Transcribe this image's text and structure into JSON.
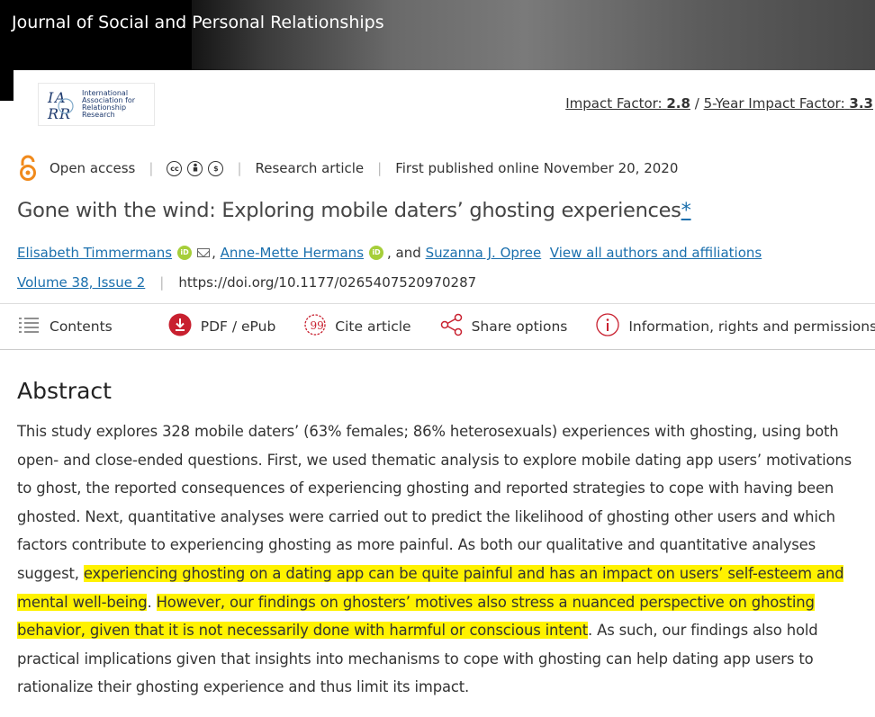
{
  "header": {
    "journal_title": "Journal of Social and Personal Relationships"
  },
  "brand": {
    "logo_text": "International Association for Relationship Research",
    "impact_label": "Impact Factor:",
    "impact_value": "2.8",
    "separator": "/",
    "five_year_label": "5-Year Impact Factor:",
    "five_year_value": "3.3"
  },
  "meta": {
    "access": "Open access",
    "article_type": "Research article",
    "published": "First published online November 20, 2020",
    "license_icons": [
      "cc-icon",
      "by-icon",
      "nc-icon"
    ]
  },
  "article": {
    "title": "Gone with the wind: Exploring mobile daters’ ghosting experiences",
    "title_mark": "*"
  },
  "authors": {
    "author1": "Elisabeth Timmermans",
    "author2": "Anne-Mette Hermans",
    "joiner": ", and",
    "author3": "Suzanna J. Opree",
    "view_all": "View all authors and affiliations",
    "orcid_label": "iD"
  },
  "issue": {
    "volume": "Volume 38, Issue 2",
    "doi": "https://doi.org/10.1177/0265407520970287"
  },
  "toolbar": {
    "contents": "Contents",
    "pdf": "PDF / ePub",
    "cite": "Cite article",
    "share": "Share options",
    "info": "Information, rights and permissions"
  },
  "abstract": {
    "heading": "Abstract",
    "text_1": "This study explores 328 mobile daters’ (63% females; 86% heterosexuals) experiences with ghosting, using both open- and close-ended questions. First, we used thematic analysis to explore mobile dating app users’ motivations to ghost, the reported consequences of experiencing ghosting and reported strategies to cope with having been ghosted. Next, quantitative analyses were carried out to predict the likelihood of ghosting other users and which factors contribute to experiencing ghosting as more painful. As both our qualitative and quantitative analyses suggest, ",
    "highlight_1": "experiencing ghosting on a dating app can be quite painful and has an impact on users’ self-esteem and mental well-being",
    "text_2": ". ",
    "highlight_2": "However, our findings on ghosters’ motives also stress a nuanced perspective on ghosting behavior, given that it is not necessarily done with harmful or conscious intent",
    "text_3": ". As such, our findings also hold practical implications given that insights into mechanisms to cope with ghosting can help dating app users to rationalize their ghosting experience and thus limit its impact."
  },
  "colors": {
    "link": "#1a6fad",
    "highlight": "#fff200",
    "open_access": "#f08a1c",
    "pdf_red": "#c8202f",
    "orcid_green": "#a6ce39"
  }
}
